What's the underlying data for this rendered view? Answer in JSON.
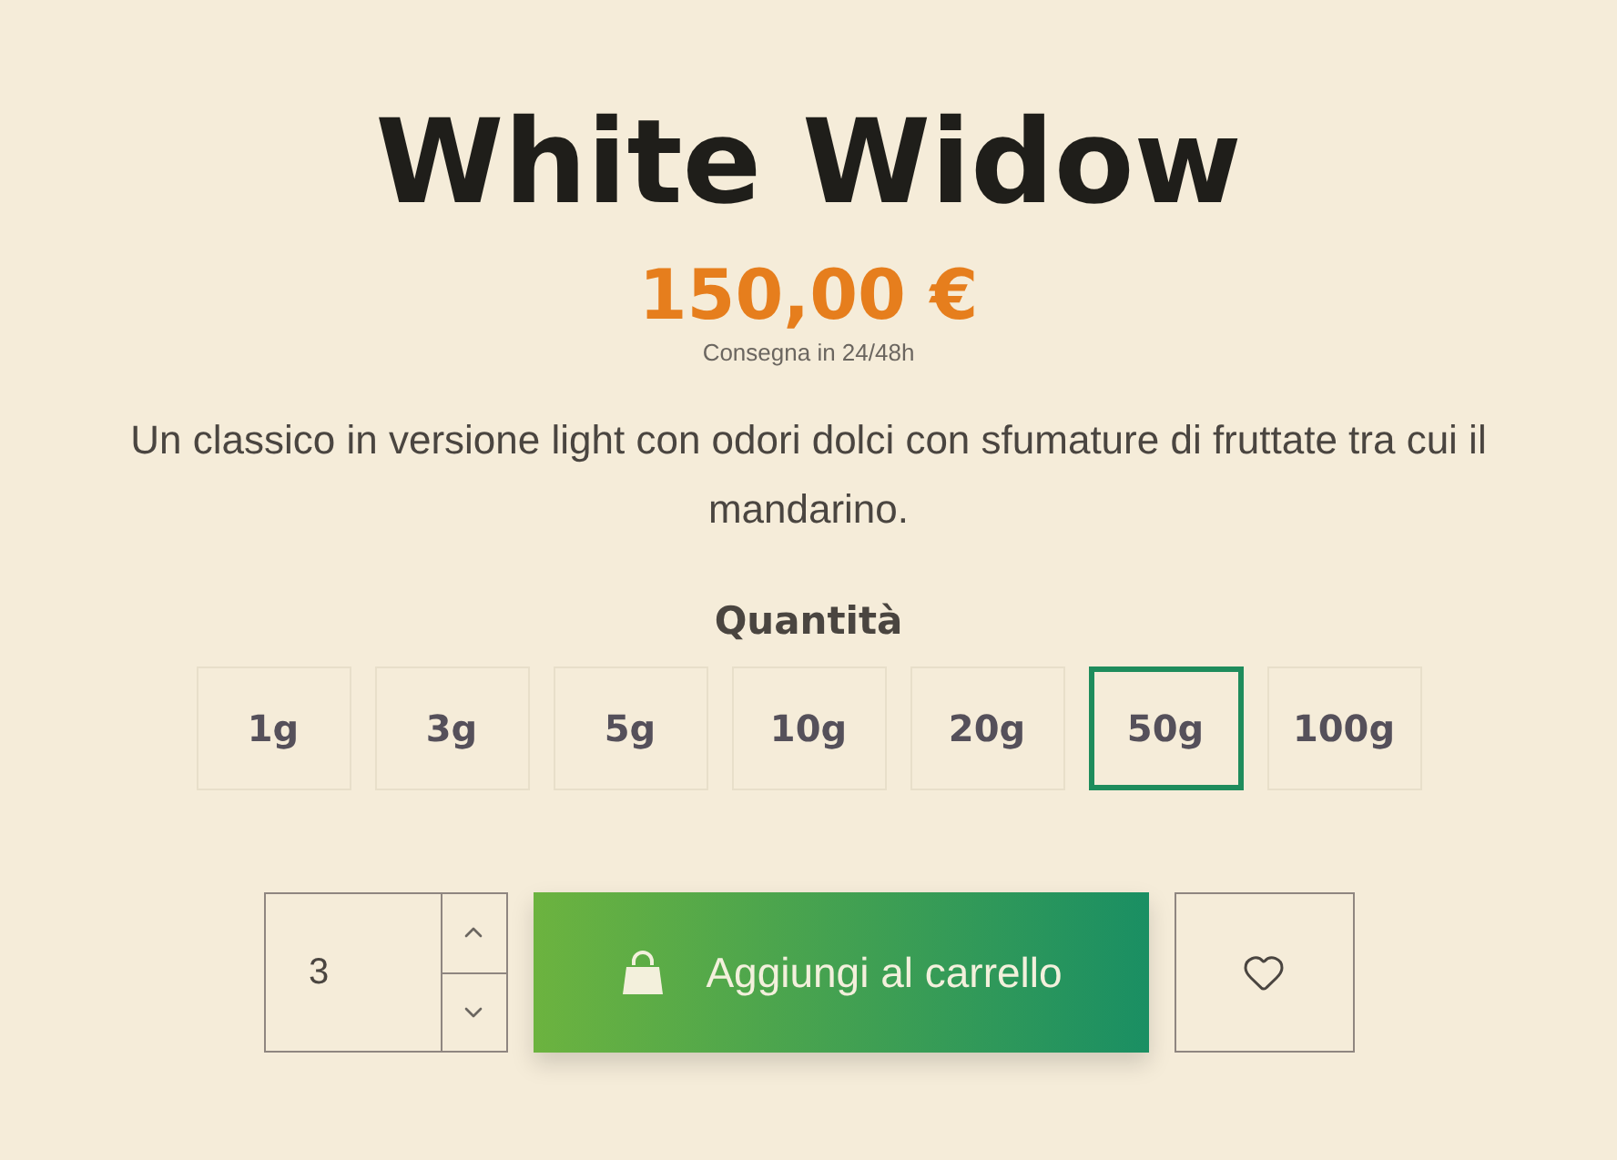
{
  "product": {
    "title": "White Widow",
    "price": "150,00 €",
    "delivery": "Consegna in 24/48h",
    "description": "Un classico in versione light con odori dolci con sfumature di fruttate tra cui il mandarino."
  },
  "quantity": {
    "label": "Quantità",
    "options": [
      {
        "label": "1g",
        "selected": false
      },
      {
        "label": "3g",
        "selected": false
      },
      {
        "label": "5g",
        "selected": false
      },
      {
        "label": "10g",
        "selected": false
      },
      {
        "label": "20g",
        "selected": false
      },
      {
        "label": "50g",
        "selected": true
      },
      {
        "label": "100g",
        "selected": false
      }
    ]
  },
  "cart": {
    "amount": "3",
    "button": "Aggiungi al carrello"
  }
}
